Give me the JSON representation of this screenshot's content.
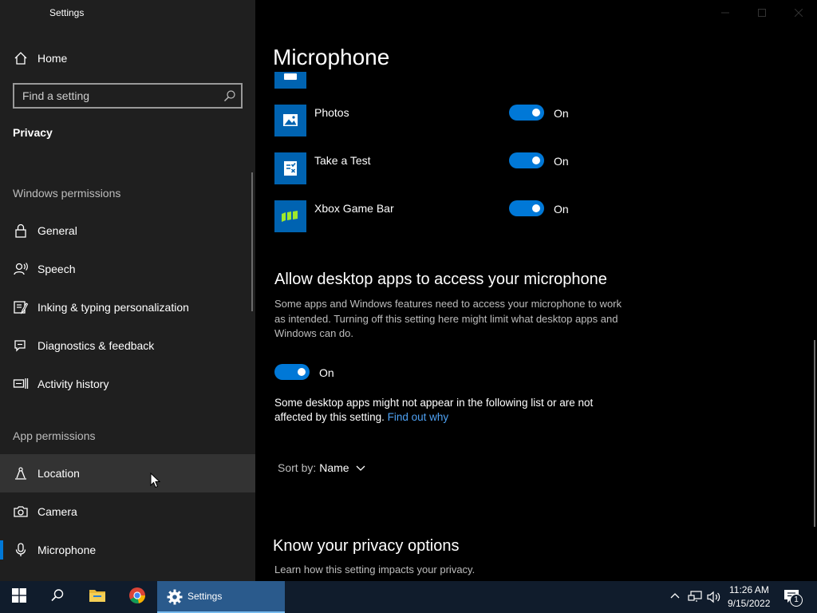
{
  "window": {
    "title": "Settings"
  },
  "sidebar": {
    "home_label": "Home",
    "search_placeholder": "Find a setting",
    "category": "Privacy",
    "windows_permissions_header": "Windows permissions",
    "windows_permissions": [
      {
        "label": "General",
        "icon": "lock-icon"
      },
      {
        "label": "Speech",
        "icon": "speech-icon"
      },
      {
        "label": "Inking & typing personalization",
        "icon": "inking-icon"
      },
      {
        "label": "Diagnostics & feedback",
        "icon": "diagnostics-icon"
      },
      {
        "label": "Activity history",
        "icon": "activity-history-icon"
      }
    ],
    "app_permissions_header": "App permissions",
    "app_permissions": [
      {
        "label": "Location",
        "icon": "location-icon",
        "state": "hover"
      },
      {
        "label": "Camera",
        "icon": "camera-icon"
      },
      {
        "label": "Microphone",
        "icon": "microphone-icon",
        "state": "selected"
      }
    ]
  },
  "main": {
    "title": "Microphone",
    "apps": [
      {
        "name": "Photos",
        "state": "On",
        "icon": "photos-icon"
      },
      {
        "name": "Take a Test",
        "state": "On",
        "icon": "take-a-test-icon"
      },
      {
        "name": "Xbox Game Bar",
        "state": "On",
        "icon": "xbox-game-bar-icon"
      }
    ],
    "desktop": {
      "heading": "Allow desktop apps to access your microphone",
      "description": "Some apps and Windows features need to access your microphone to work as intended. Turning off this setting here might limit what desktop apps and Windows can do.",
      "toggle_state": "On",
      "note": "Some desktop apps might not appear in the following list or are not affected by this setting.",
      "link": "Find out why"
    },
    "sort": {
      "label": "Sort by:",
      "value": "Name"
    },
    "privacy": {
      "heading": "Know your privacy options",
      "description": "Learn how this setting impacts your privacy."
    }
  },
  "taskbar": {
    "settings_label": "Settings",
    "time": "11:26 AM",
    "date": "9/15/2022",
    "notification_count": "1"
  },
  "colors": {
    "accent": "#0078d7",
    "sidebar_bg": "#1f1f1f",
    "taskbar_bg": "#101c2c",
    "link": "#4ea1f3"
  }
}
